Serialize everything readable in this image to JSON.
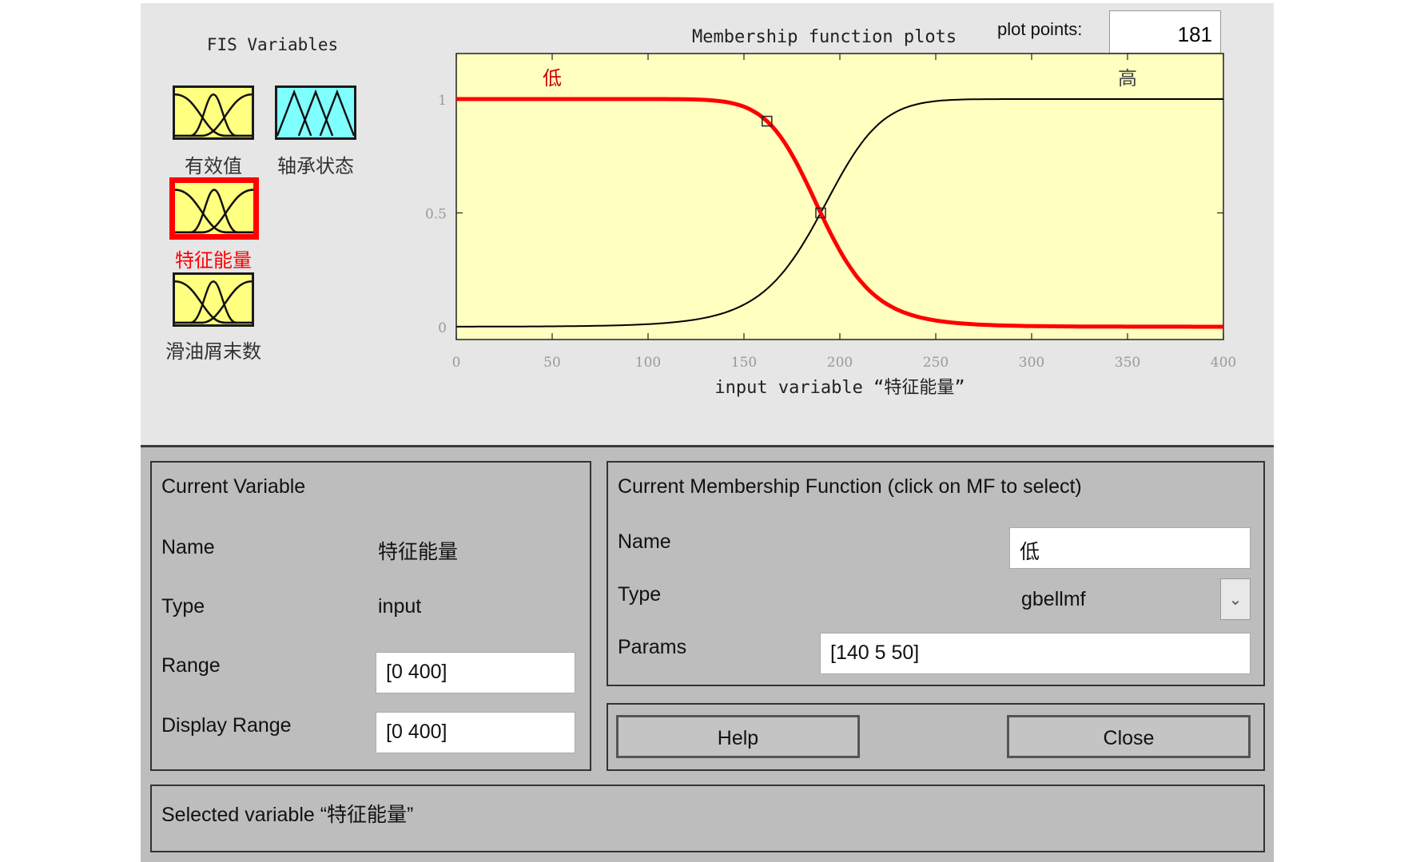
{
  "fis_panel": {
    "title": "FIS Variables",
    "variables": [
      {
        "label": "有效值",
        "icon": "input-mf-icon",
        "color": "#ffff80",
        "selected": false
      },
      {
        "label": "轴承状态",
        "icon": "output-mf-icon",
        "color": "#80ffff",
        "selected": false
      },
      {
        "label": "特征能量",
        "icon": "input-mf-icon",
        "color": "#ffff80",
        "selected": true
      },
      {
        "label": "滑油屑末数",
        "icon": "input-mf-icon",
        "color": "#ffff80",
        "selected": false
      }
    ]
  },
  "plot": {
    "title": "Membership function plots",
    "plot_points_label": "plot points:",
    "plot_points_value": "181"
  },
  "chart_data": {
    "type": "line",
    "xlabel": "input variable “特征能量”",
    "ylabel": "",
    "xlim": [
      0,
      400
    ],
    "ylim": [
      0,
      1
    ],
    "x_ticks": [
      "0",
      "50",
      "100",
      "150",
      "200",
      "250",
      "300",
      "350",
      "400"
    ],
    "y_ticks": [
      "0",
      "0.5",
      "1"
    ],
    "background": "#ffffc0",
    "series": [
      {
        "name": "低",
        "mf": "gbellmf",
        "params": [
          140,
          5,
          50
        ],
        "color": "#ff0000",
        "selected": true
      },
      {
        "name": "高",
        "mf": "gbellmf",
        "params": [
          160,
          5,
          350
        ],
        "color": "#000000",
        "selected": false
      }
    ]
  },
  "current_variable": {
    "title": "Current Variable",
    "name_label": "Name",
    "name_value": "特征能量",
    "type_label": "Type",
    "type_value": "input",
    "range_label": "Range",
    "range_value": "[0 400]",
    "display_range_label": "Display Range",
    "display_range_value": "[0 400]"
  },
  "current_mf": {
    "title": "Current Membership Function (click on MF to select)",
    "name_label": "Name",
    "name_value": "低",
    "type_label": "Type",
    "type_value": "gbellmf",
    "params_label": "Params",
    "params_value": "[140 5 50]"
  },
  "buttons": {
    "help": "Help",
    "close": "Close"
  },
  "status": "Selected variable “特征能量”"
}
